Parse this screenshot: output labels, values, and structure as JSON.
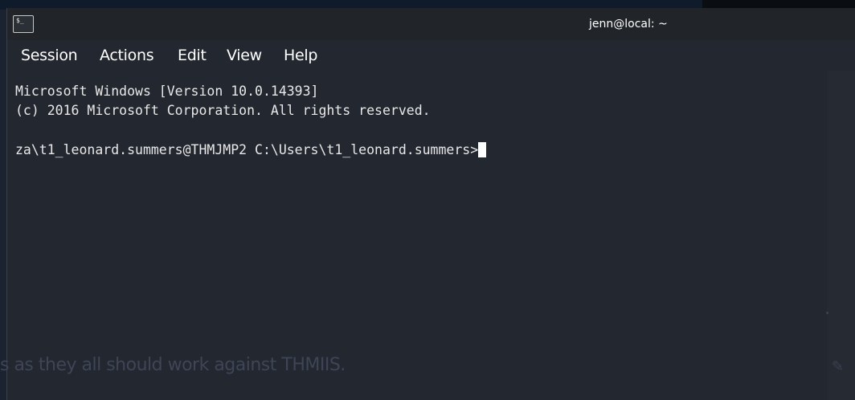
{
  "window": {
    "title": "jenn@local: ~",
    "icon": "terminal-icon"
  },
  "menu": {
    "items": [
      "Session",
      "Actions",
      "Edit",
      "View",
      "Help"
    ]
  },
  "terminal": {
    "lines": [
      "Microsoft Windows [Version 10.0.14393]",
      "(c) 2016 Microsoft Corporation. All rights reserved.",
      "",
      "za\\t1_leonard.summers@THMJMP2 C:\\Users\\t1_leonard.summers>"
    ]
  },
  "background": {
    "text": "s as they all should work against THMIIS."
  },
  "colors": {
    "window_bg": "#232730",
    "titlebar_bg": "#212429",
    "text": "#e8e8e8"
  }
}
